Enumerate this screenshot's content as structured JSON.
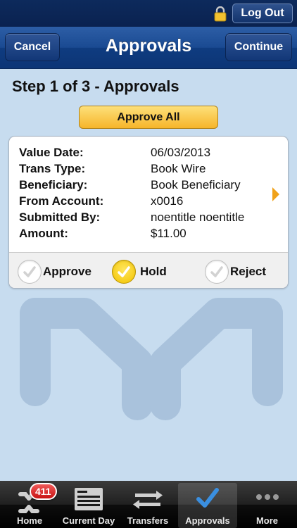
{
  "header": {
    "logout_label": "Log Out"
  },
  "navbar": {
    "title": "Approvals",
    "cancel_label": "Cancel",
    "continue_label": "Continue"
  },
  "step_title": "Step 1 of 3 - Approvals",
  "approve_all_label": "Approve All",
  "transaction": {
    "fields": [
      {
        "label": "Value Date:",
        "value": "06/03/2013"
      },
      {
        "label": "Trans Type:",
        "value": "Book Wire"
      },
      {
        "label": "Beneficiary:",
        "value": "Book Beneficiary"
      },
      {
        "label": "From Account:",
        "value": "x0016"
      },
      {
        "label": "Submitted By:",
        "value": "noentitle noentitle"
      },
      {
        "label": "Amount:",
        "value": "$11.00"
      }
    ],
    "options": [
      {
        "label": "Approve",
        "selected": false
      },
      {
        "label": "Hold",
        "selected": true
      },
      {
        "label": "Reject",
        "selected": false
      }
    ]
  },
  "tabbar": {
    "badge_count": "411",
    "tabs": [
      {
        "label": "Home",
        "icon": "home-logo-icon"
      },
      {
        "label": "Current Day",
        "icon": "document-icon"
      },
      {
        "label": "Transfers",
        "icon": "transfer-arrows-icon"
      },
      {
        "label": "Approvals",
        "icon": "checkmark-icon",
        "active": true
      },
      {
        "label": "More",
        "icon": "more-dots-icon"
      }
    ]
  },
  "colors": {
    "background": "#c7dcef",
    "nav_blue": "#1a4a92",
    "accent_yellow": "#f6b52a",
    "chevron_orange": "#f0a21a",
    "badge_red": "#d41c1c"
  }
}
